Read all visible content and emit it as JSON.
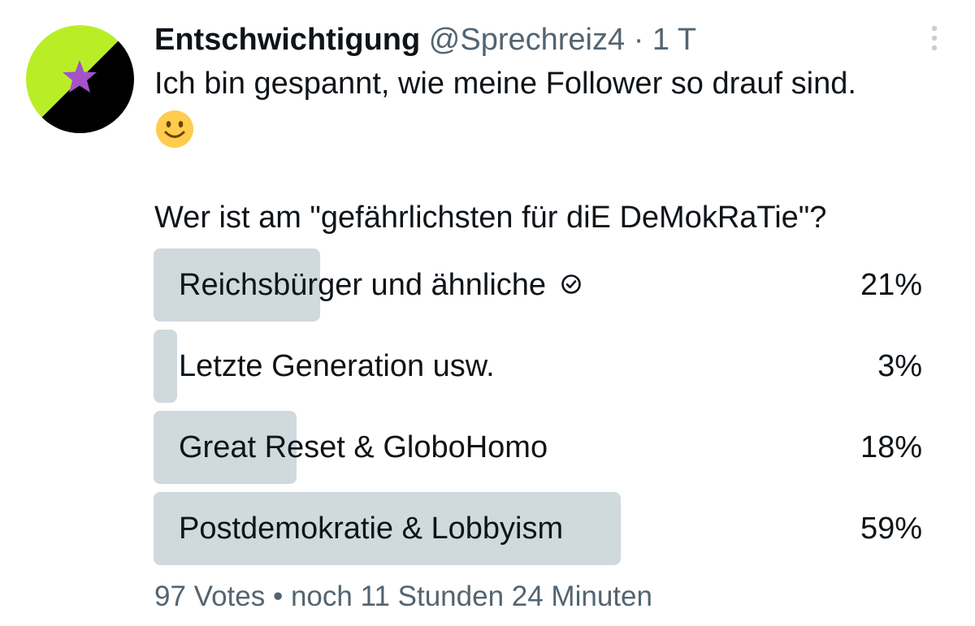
{
  "tweet": {
    "display_name": "Entschwichtigung",
    "handle": "@Sprechreiz4",
    "separator": "·",
    "time": "1 T",
    "text_line1": "Ich bin gespannt, wie meine Follower so drauf sind.",
    "emoji": "slightly-smiling-face",
    "text_line2": "Wer ist am \"gefährlichsten für diE DeMokRaTie\"?"
  },
  "avatar": {
    "colors": {
      "top_left": "#b9ee27",
      "bottom_right": "#000000",
      "star": "#a352c8"
    }
  },
  "poll": {
    "options": [
      {
        "label": "Reichsbürger und ähnliche",
        "percent_label": "21%",
        "percent": 21,
        "selected": true
      },
      {
        "label": "Letzte Generation usw.",
        "percent_label": "3%",
        "percent": 3,
        "selected": false
      },
      {
        "label": "Great Reset & GloboHomo",
        "percent_label": "18%",
        "percent": 18,
        "selected": false
      },
      {
        "label": "Postdemokratie & Lobbyism",
        "percent_label": "59%",
        "percent": 59,
        "selected": false
      }
    ],
    "votes": "97 Votes",
    "dot": "•",
    "remaining": "noch 11 Stunden 24 Minuten",
    "bar_color": "#cfd9de"
  }
}
